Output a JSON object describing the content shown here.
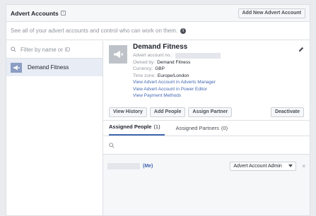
{
  "header": {
    "title": "Advert Accounts",
    "add_button": "Add New Advert Account"
  },
  "subbar": {
    "text": "See all of your advert accounts and control who can work on them."
  },
  "sidebar": {
    "search_placeholder": "Filter by name or ID",
    "accounts": [
      {
        "name": "Demand Fitness",
        "selected": true
      }
    ]
  },
  "account": {
    "name": "Demand Fitness",
    "fields": [
      {
        "label": "Advert account no.:",
        "value": ""
      },
      {
        "label": "Owned by:",
        "value": "Demand Fitness"
      },
      {
        "label": "Currency:",
        "value": "GBP"
      },
      {
        "label": "Time zone:",
        "value": "Europe/London"
      }
    ],
    "links": [
      "View Advert Account in Adverts Manager",
      "View Advert Account in Power Editor",
      "View Payment Methods"
    ],
    "buttons": {
      "view_history": "View History",
      "add_people": "Add People",
      "assign_partner": "Assign Partner",
      "deactivate": "Deactivate"
    }
  },
  "tabs": [
    {
      "label": "Assigned People",
      "count": "(1)",
      "active": true
    },
    {
      "label": "Assigned Partners",
      "count": "(0)",
      "active": false
    }
  ],
  "people": [
    {
      "me_label": "(Me)",
      "role": "Advert Account Admin"
    }
  ],
  "colors": {
    "accent": "#4267b2",
    "selected_bg": "#e7ecf5",
    "border": "#dddfe2"
  }
}
